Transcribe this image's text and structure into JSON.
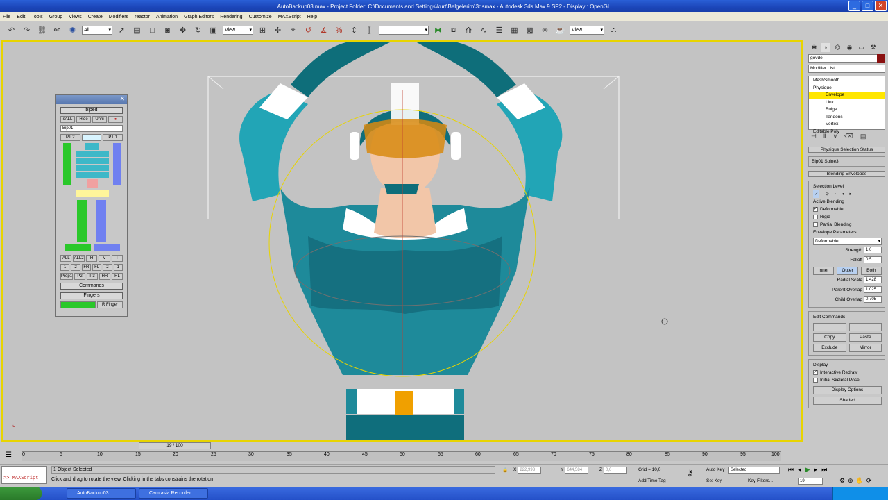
{
  "window": {
    "title": "AutoBackup03.max    - Project Folder: C:\\Documents and Settings\\kurt\\Belgelerim\\3dsmax    - Autodesk 3ds Max 9 SP2    - Display : OpenGL"
  },
  "menu": [
    "File",
    "Edit",
    "Tools",
    "Group",
    "Views",
    "Create",
    "Modifiers",
    "reactor",
    "Animation",
    "Graph Editors",
    "Rendering",
    "Customize",
    "MAXScript",
    "Help"
  ],
  "toolbar": {
    "filter_value": "All",
    "refcoord_value": "View",
    "named_sel_value": "",
    "view2_value": "View"
  },
  "biped": {
    "title": "biped",
    "row1": [
      "sALL",
      "Hide",
      "Unhi"
    ],
    "object_name": "Bip01",
    "pt_left": "PT 2",
    "pt_right": "PT 1",
    "row_all": [
      "ALL",
      "ALL2",
      "H",
      "V",
      "T"
    ],
    "row_nums": [
      "1",
      "2",
      "FR",
      "FL",
      "2",
      "1"
    ],
    "row_props": [
      "Prop1",
      "P2",
      "P3",
      "HR",
      "HL"
    ],
    "commands_label": "Commands",
    "fingers_label": "Fingers",
    "r_finger": "R Finger"
  },
  "command_panel": {
    "object_name": "govde",
    "modifier_list": "Modifier List",
    "stack": [
      "MeshSmooth",
      "Physique",
      "Envelope",
      "Link",
      "Bulge",
      "Tendons",
      "Vertex",
      "Editable Poly"
    ],
    "selected_stack_index": 2,
    "physique_status_title": "Physique Selection Status",
    "selection_status": "Bip01 Spine3",
    "blending_title": "Blending Envelopes",
    "selection_level_label": "Selection Level",
    "active_blending_label": "Active Blending",
    "deformable_label": "Deformable",
    "rigid_label": "Rigid",
    "partial_label": "Partial Blending",
    "env_params_label": "Envelope Parameters",
    "env_type": "Deformable",
    "strength_label": "Strength",
    "strength_value": "1,0",
    "falloff_label": "Falloff",
    "falloff_value": "0,5",
    "inner_label": "Inner",
    "outer_label": "Outer",
    "both_label": "Both",
    "radial_scale_label": "Radial Scale",
    "radial_scale_value": "1,428",
    "parent_overlap_label": "Parent Overlap",
    "parent_overlap_value": "1,025",
    "child_overlap_label": "Child Overlap",
    "child_overlap_value": "0,705",
    "edit_commands_label": "Edit Commands",
    "copy_label": "Copy",
    "paste_label": "Paste",
    "exclude_label": "Exclude",
    "mirror_label": "Mirror",
    "display_label": "Display",
    "interactive_redraw_label": "Interactive Redraw",
    "initial_skeletal_label": "Initial Skeletal Pose",
    "display_options_label": "Display Options",
    "shaded_label": "Shaded"
  },
  "timeline": {
    "slider_label": "19 / 100",
    "ticks": [
      "0",
      "5",
      "10",
      "15",
      "20",
      "25",
      "30",
      "35",
      "40",
      "45",
      "50",
      "55",
      "60",
      "65",
      "70",
      "75",
      "80",
      "85",
      "90",
      "95",
      "100"
    ]
  },
  "status": {
    "maxscript_prompt": ">> MAXScript",
    "selection": "1 Object Selected",
    "prompt": "Click and drag to rotate the view.  Clicking in the tabs constrains the rotation",
    "x_label": "X",
    "x_value": "222,993",
    "y_label": "Y",
    "y_value": "644,584",
    "z_label": "Z",
    "z_value": "0,0",
    "grid": "Grid = 10,0",
    "add_time_tag": "Add Time Tag",
    "auto_key": "Auto Key",
    "set_key": "Set Key",
    "key_mode": "Selected",
    "key_filters": "Key Filters...",
    "frame": "19"
  },
  "taskbar": {
    "task1": "AutoBackup03",
    "task2": "Camtasia Recorder"
  },
  "colors": {
    "accent_yellow": "#ffe600",
    "viewport_bg": "#c3c3c3",
    "character_teal": "#1e8a9a",
    "buckle": "#f0a000"
  }
}
